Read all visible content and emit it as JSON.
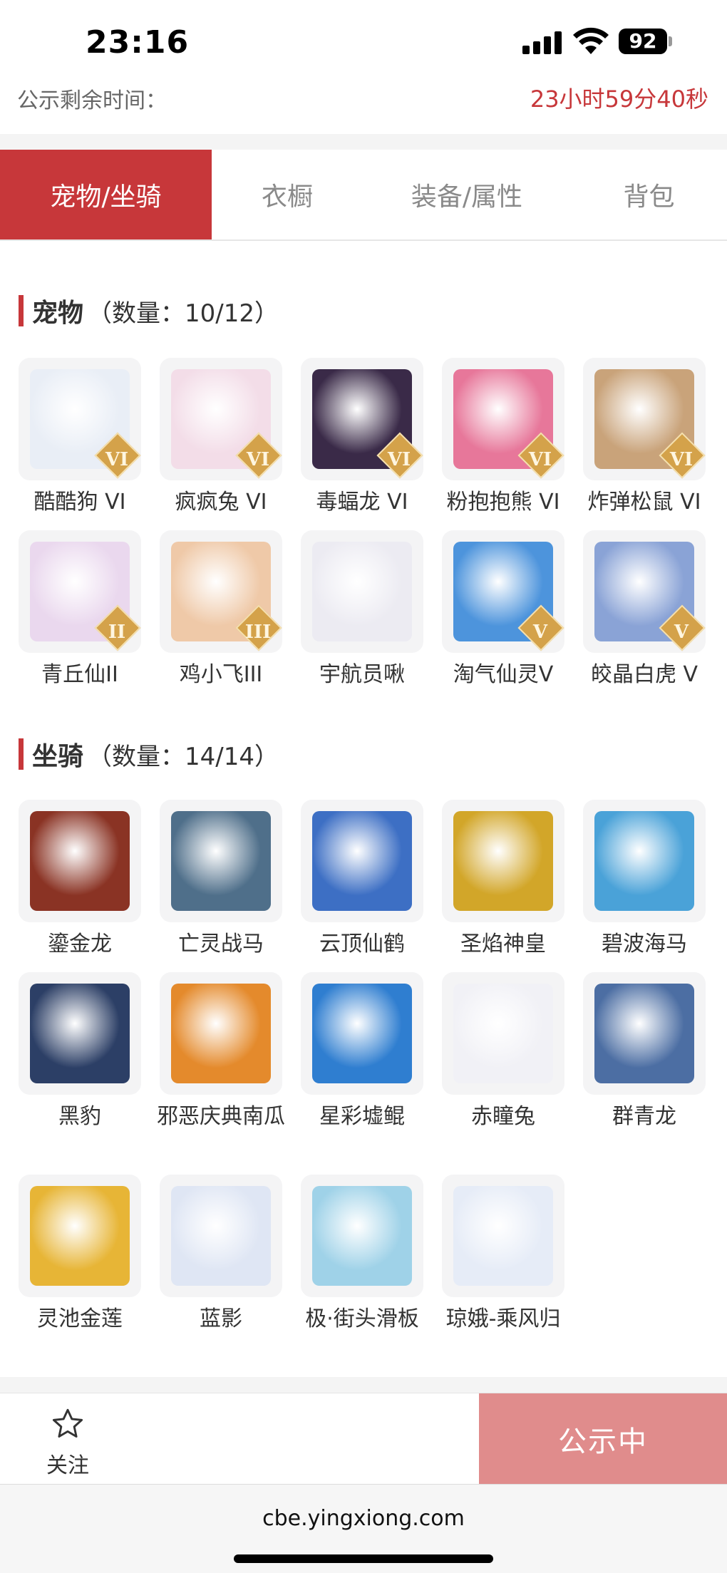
{
  "status_bar": {
    "time": "23:16",
    "battery": "92"
  },
  "countdown": {
    "label": "公示剩余时间：",
    "value": "23小时59分40秒"
  },
  "tabs": [
    {
      "label": "宠物/坐骑",
      "active": true
    },
    {
      "label": "衣橱",
      "active": false
    },
    {
      "label": "装备/属性",
      "active": false
    },
    {
      "label": "背包",
      "active": false
    }
  ],
  "pets": {
    "title": "宠物",
    "count": "（数量：10/12）",
    "items": [
      {
        "name": "酷酷狗 VI",
        "icon": "polar-bear-goggles-icon",
        "badge": "VI",
        "color": "#e9eef6"
      },
      {
        "name": "疯疯兔 VI",
        "icon": "bunny-icon",
        "badge": "VI",
        "color": "#f3dde8"
      },
      {
        "name": "毒蝠龙 VI",
        "icon": "dark-dragon-icon",
        "badge": "VI",
        "color": "#3a2a48"
      },
      {
        "name": "粉抱抱熊 VI",
        "icon": "pink-bear-icon",
        "badge": "VI",
        "color": "#e7779a"
      },
      {
        "name": "炸弹松鼠 VI",
        "icon": "squirrel-icon",
        "badge": "VI",
        "color": "#c9a37a"
      },
      {
        "name": "青丘仙II",
        "icon": "fox-fairy-icon",
        "badge": "II",
        "color": "#ead8ee"
      },
      {
        "name": "鸡小飞III",
        "icon": "chick-fighter-icon",
        "badge": "III",
        "color": "#efc9a8"
      },
      {
        "name": "宇航员啾",
        "icon": "astronaut-cow-icon",
        "badge": "",
        "color": "#ecebf2"
      },
      {
        "name": "淘气仙灵V",
        "icon": "blue-puppy-icon",
        "badge": "V",
        "color": "#4d94dc"
      },
      {
        "name": "皎晶白虎 V",
        "icon": "white-tiger-icon",
        "badge": "V",
        "color": "#8aa3d6"
      }
    ]
  },
  "mounts": {
    "title": "坐骑",
    "count": "（数量：14/14）",
    "items": [
      {
        "name": "鎏金龙",
        "icon": "golden-dragon-icon",
        "color": "#8a3324"
      },
      {
        "name": "亡灵战马",
        "icon": "undead-horse-icon",
        "color": "#4f6f8a"
      },
      {
        "name": "云顶仙鹤",
        "icon": "crane-icon",
        "color": "#3d6fc4"
      },
      {
        "name": "圣焰神皇",
        "icon": "phoenix-icon",
        "color": "#d2a629"
      },
      {
        "name": "碧波海马",
        "icon": "seahorse-icon",
        "color": "#4aa2d8"
      },
      {
        "name": "黑豹",
        "icon": "panther-icon",
        "color": "#2c3f66"
      },
      {
        "name": "邪恶庆典南瓜",
        "icon": "pumpkin-icon",
        "color": "#e48a2c"
      },
      {
        "name": "星彩墟鲲",
        "icon": "whale-icon",
        "color": "#2f7ed0"
      },
      {
        "name": "赤瞳兔",
        "icon": "white-rabbit-icon",
        "color": "#f1f1f6"
      },
      {
        "name": "群青龙",
        "icon": "azure-dragon-icon",
        "color": "#4c6ea3"
      },
      {
        "name": "灵池金莲",
        "icon": "lotus-icon",
        "color": "#e7b536"
      },
      {
        "name": "蓝影",
        "icon": "ice-tiger-icon",
        "color": "#dfe6f4"
      },
      {
        "name": "极·街头滑板",
        "icon": "skateboard-icon",
        "color": "#9fd2e8"
      },
      {
        "name": "琼娥-乘风归",
        "icon": "moon-fairy-icon",
        "color": "#e6ecf7"
      }
    ]
  },
  "action_bar": {
    "follow_label": "关注",
    "status_label": "公示中"
  },
  "browser": {
    "url": "cbe.yingxiong.com"
  },
  "colors": {
    "accent": "#c7373a",
    "status_button": "#e08c8c"
  }
}
